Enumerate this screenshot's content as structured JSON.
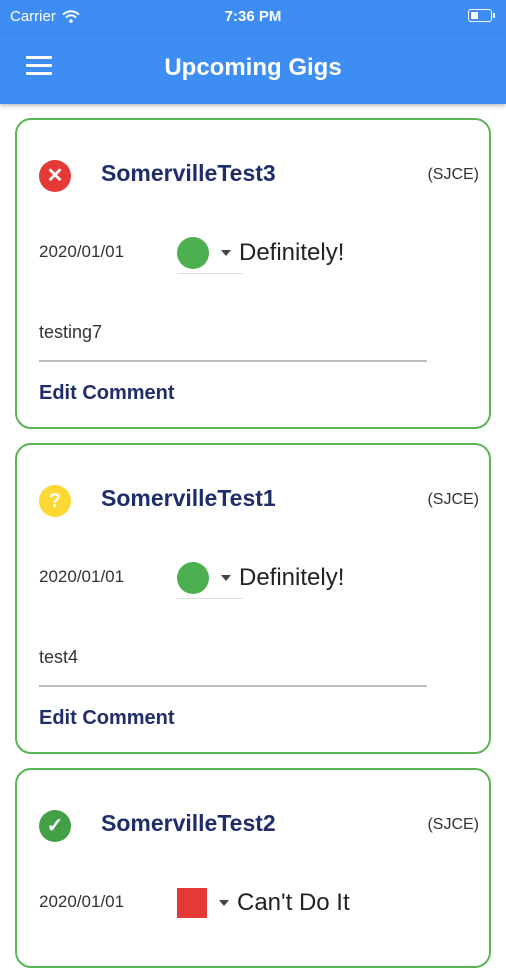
{
  "status_bar": {
    "carrier": "Carrier",
    "time": "7:36 PM",
    "icons": [
      "wifi-icon",
      "battery-icon"
    ]
  },
  "app_bar": {
    "title": "Upcoming Gigs",
    "menu_icon": "menu-icon"
  },
  "colors": {
    "primary": "#3d8df3",
    "card_border": "#5ab552",
    "title_text": "#1f2d6a",
    "status_error": "#e53935",
    "status_unknown": "#fdd835",
    "status_ok": "#43a047",
    "rsvp_yes": "#4caf50",
    "rsvp_no": "#e53935"
  },
  "gigs": [
    {
      "status_icon": "x-circle-icon",
      "title": "SomervilleTest3",
      "venue": "(SJCE)",
      "date": "2020/01/01",
      "rsvp": "Definitely!",
      "comment": "testing7",
      "edit_label": "Edit Comment"
    },
    {
      "status_icon": "question-circle-icon",
      "title": "SomervilleTest1",
      "venue": "(SJCE)",
      "date": "2020/01/01",
      "rsvp": "Definitely!",
      "comment": "test4",
      "edit_label": "Edit Comment"
    },
    {
      "status_icon": "check-circle-icon",
      "title": "SomervilleTest2",
      "venue": "(SJCE)",
      "date": "2020/01/01",
      "rsvp": "Can't Do It",
      "comment": "",
      "edit_label": ""
    }
  ]
}
